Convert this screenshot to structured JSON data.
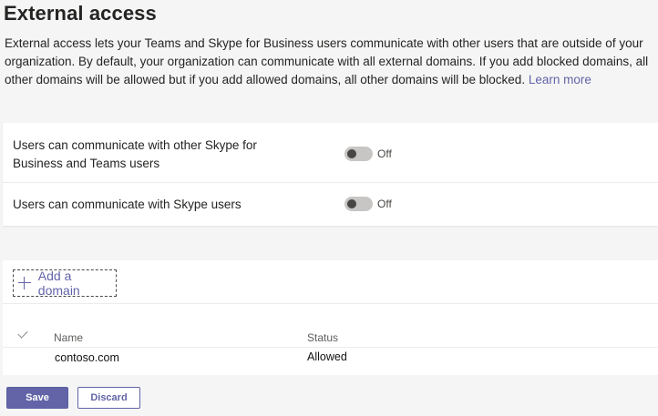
{
  "page": {
    "title": "External access",
    "description": "External access lets your Teams and Skype for Business users communicate with other users that are outside of your organization. By default, your organization can communicate with all external domains. If you add blocked domains, all other domains will be allowed but if you add allowed domains, all other domains will be blocked.",
    "learn_more": "Learn more"
  },
  "settings": [
    {
      "label": "Users can communicate with other Skype for Business and Teams users",
      "state": "Off",
      "enabled": false
    },
    {
      "label": "Users can communicate with Skype users",
      "state": "Off",
      "enabled": false
    }
  ],
  "domains": {
    "add_label": "Add a domain",
    "icon": "plus-icon",
    "columns": {
      "name": "Name",
      "status": "Status"
    },
    "rows": [
      {
        "name": "contoso.com",
        "status": "Allowed"
      }
    ]
  },
  "actions": {
    "save_label": "Save",
    "discard_label": "Discard"
  },
  "colors": {
    "accent": "#6264a7",
    "background": "#f5f5f5",
    "card": "#ffffff",
    "toggle_off": "#c8c6c4"
  }
}
